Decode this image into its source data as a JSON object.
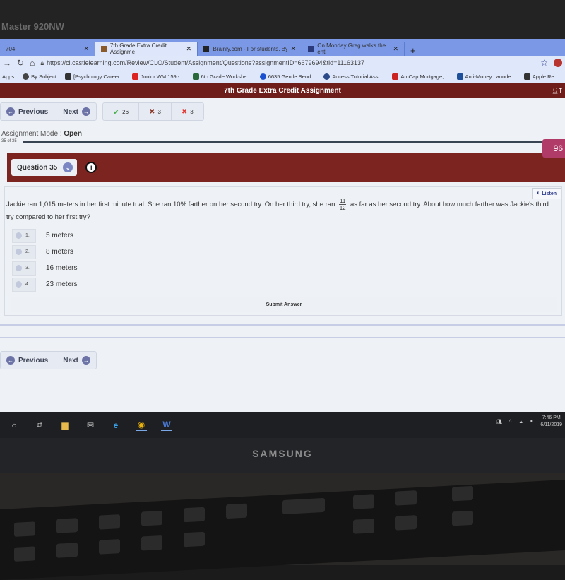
{
  "monitor": {
    "label": "Master 920NW",
    "brand": "SAMSUNG"
  },
  "browser": {
    "tabs": [
      {
        "title": "704",
        "active": false
      },
      {
        "title": "7th Grade Extra Credit Assignme",
        "active": true
      },
      {
        "title": "Brainly.com - For students. By st",
        "active": false
      },
      {
        "title": "On Monday Greg walks the enti",
        "active": false
      }
    ],
    "new_tab": "+",
    "url": "https://cl.castlelearning.com/Review/CLO/Student/Assignment/Questions?assignmentID=6679694&tid=11163137",
    "bookmarks": [
      "Apps",
      "By Subject",
      "[Psychology Career...",
      "Junior WM 159 -...",
      "6th Grade Workshe...",
      "6635 Gentle Bend...",
      "Access Tutorial Assi...",
      "AmCap Mortgage,...",
      "Anti-Money Launde...",
      "Apple Re"
    ]
  },
  "app": {
    "title": "7th Grade Extra Credit Assignment",
    "user_initial": "T",
    "previous_label": "Previous",
    "next_label": "Next",
    "stats": {
      "correct": "26",
      "partial": "3",
      "wrong": "3"
    },
    "score": "96",
    "mode_label": "Assignment Mode :",
    "mode_value": "Open",
    "progress_label": "35 of 35",
    "progress_fraction": 1.0,
    "question_select": "Question 35",
    "listen_label": "Listen",
    "question": {
      "part1": "Jackie ran 1,015 meters in her first minute trial. She ran 10% farther on her second try. On her third try, she ran",
      "frac_num": "11",
      "frac_den": "12",
      "part2": "as far as her second try. About how much farther was Jackie's third try compared to her first try?"
    },
    "choices": [
      {
        "num": "1.",
        "text": "5 meters"
      },
      {
        "num": "2.",
        "text": "8 meters"
      },
      {
        "num": "3.",
        "text": "16 meters"
      },
      {
        "num": "4.",
        "text": "23 meters"
      }
    ],
    "submit_label": "Submit Answer"
  },
  "taskbar": {
    "time": "7:46 PM",
    "date": "6/11/2019"
  }
}
